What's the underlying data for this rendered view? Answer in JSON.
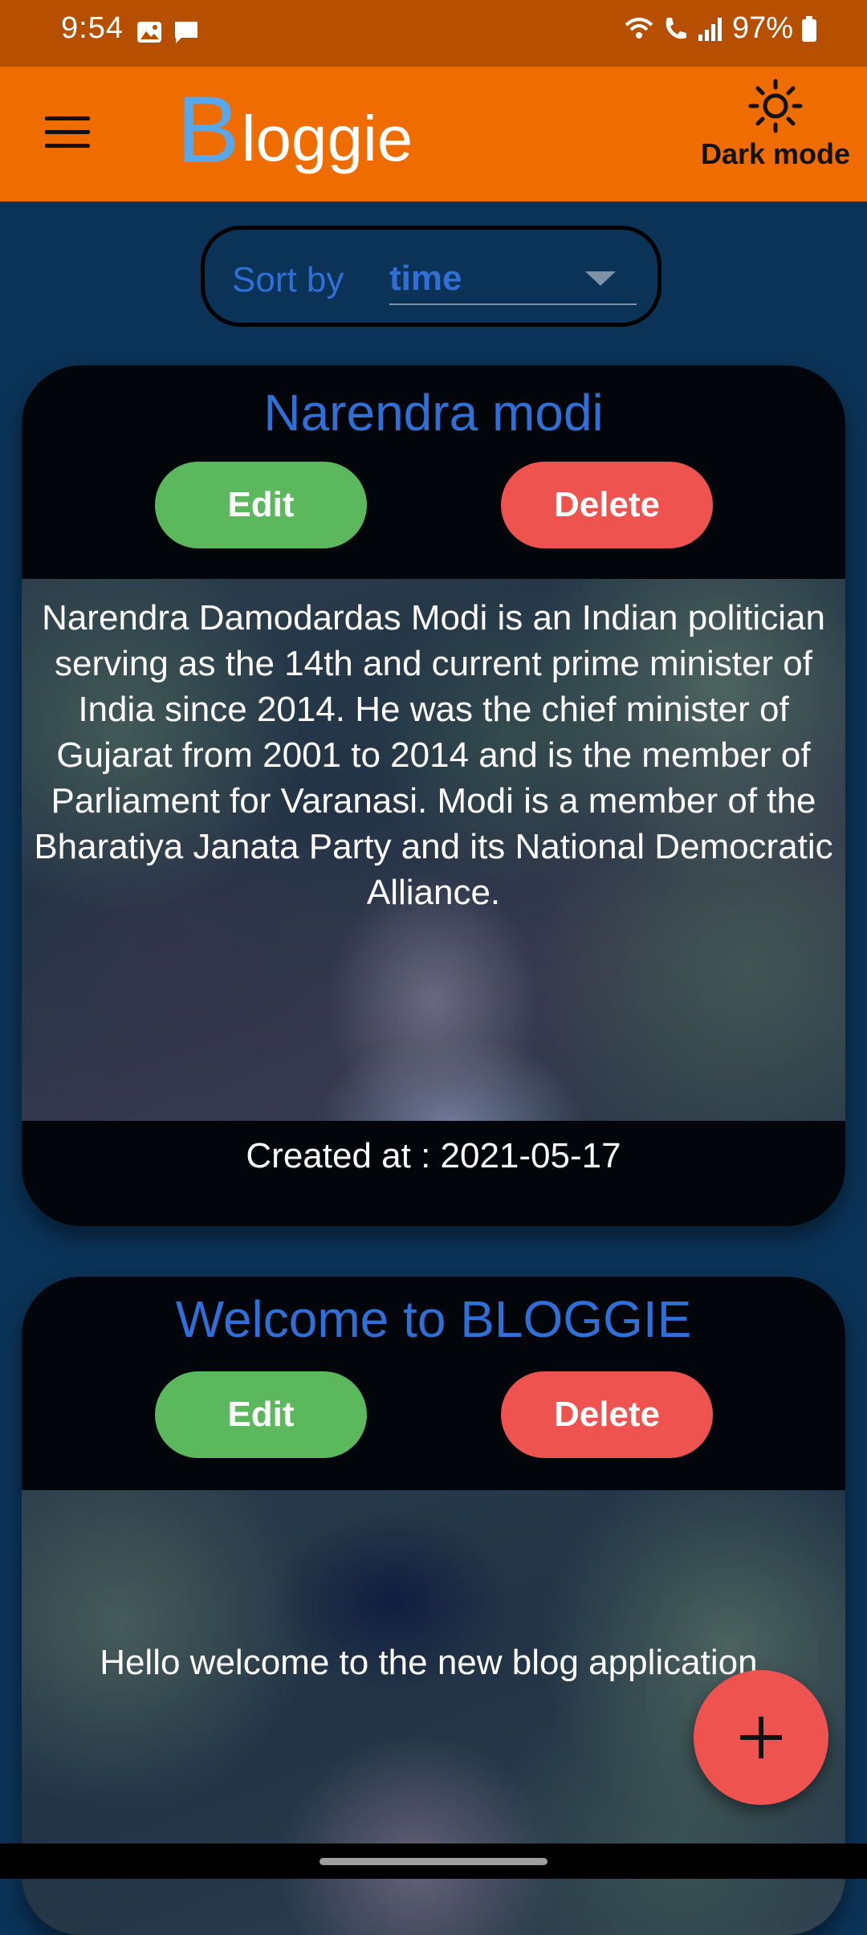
{
  "status_bar": {
    "time": "9:54",
    "battery_percent": "97%"
  },
  "app_bar": {
    "brand_initial": "B",
    "brand_rest": "loggie",
    "dark_mode_label": "Dark mode"
  },
  "sort": {
    "label": "Sort by",
    "value": "time"
  },
  "posts": [
    {
      "title": "Narendra modi",
      "edit_label": "Edit",
      "delete_label": "Delete",
      "body": "Narendra Damodardas Modi is an Indian politician serving as the 14th and current prime minister of India since 2014. He was the chief minister of Gujarat from 2001 to 2014 and is the member of Parliament for Varanasi. Modi is a member of the Bharatiya Janata Party and its National Democratic Alliance.",
      "created_at": "Created at : 2021-05-17"
    },
    {
      "title": "Welcome to BLOGGIE",
      "edit_label": "Edit",
      "delete_label": "Delete",
      "body": "Hello welcome to the new blog application."
    }
  ],
  "colors": {
    "app_bar": "#ef6c00",
    "status_bar": "#b64f00",
    "background": "#0b3358",
    "accent_blue": "#2f6fd6",
    "edit_green": "#5cb85c",
    "delete_red": "#ee5350"
  }
}
